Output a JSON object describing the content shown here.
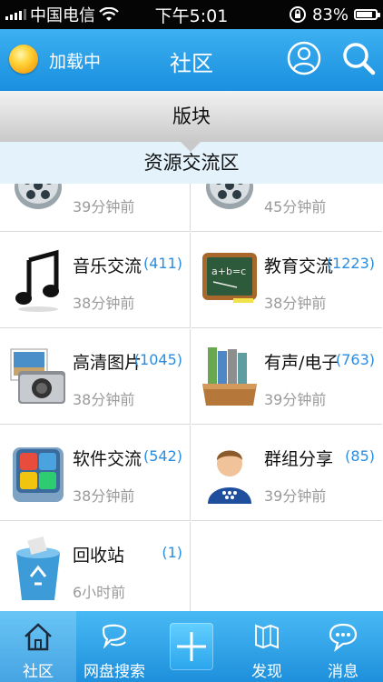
{
  "status_bar": {
    "carrier": "中国电信",
    "time": "下午5:01",
    "battery": "83%",
    "battery_level": 0.83
  },
  "nav": {
    "loading_text": "加载中",
    "title": "社区",
    "accent": "#1a8fde"
  },
  "section": {
    "title": "版块",
    "subtitle": "资源交流区"
  },
  "forums": [
    {
      "title": "",
      "count": "",
      "time": "39分钟前",
      "icon": "film-reel-icon"
    },
    {
      "title": "",
      "count": "",
      "time": "45分钟前",
      "icon": "film-reel-icon"
    },
    {
      "title": "音乐交流",
      "count": "(411)",
      "time": "38分钟前",
      "icon": "music-note-icon"
    },
    {
      "title": "教育交流",
      "count": "(1223)",
      "time": "38分钟前",
      "icon": "chalkboard-icon"
    },
    {
      "title": "高清图片",
      "count": "(1045)",
      "time": "38分钟前",
      "icon": "camera-photos-icon"
    },
    {
      "title": "有声/电子",
      "count": "(763)",
      "time": "39分钟前",
      "icon": "binders-icon"
    },
    {
      "title": "软件交流",
      "count": "(542)",
      "time": "38分钟前",
      "icon": "software-box-icon"
    },
    {
      "title": "群组分享",
      "count": "(85)",
      "time": "39分钟前",
      "icon": "group-user-icon"
    },
    {
      "title": "回收站",
      "count": "(1)",
      "time": "6小时前",
      "icon": "recycle-bin-icon"
    }
  ],
  "tabs": [
    {
      "label": "社区",
      "icon": "home-icon"
    },
    {
      "label": "网盘搜索",
      "icon": "chat-bubble-icon"
    },
    {
      "label": "",
      "icon": "plus-icon"
    },
    {
      "label": "发现",
      "icon": "map-icon"
    },
    {
      "label": "消息",
      "icon": "message-icon"
    }
  ]
}
